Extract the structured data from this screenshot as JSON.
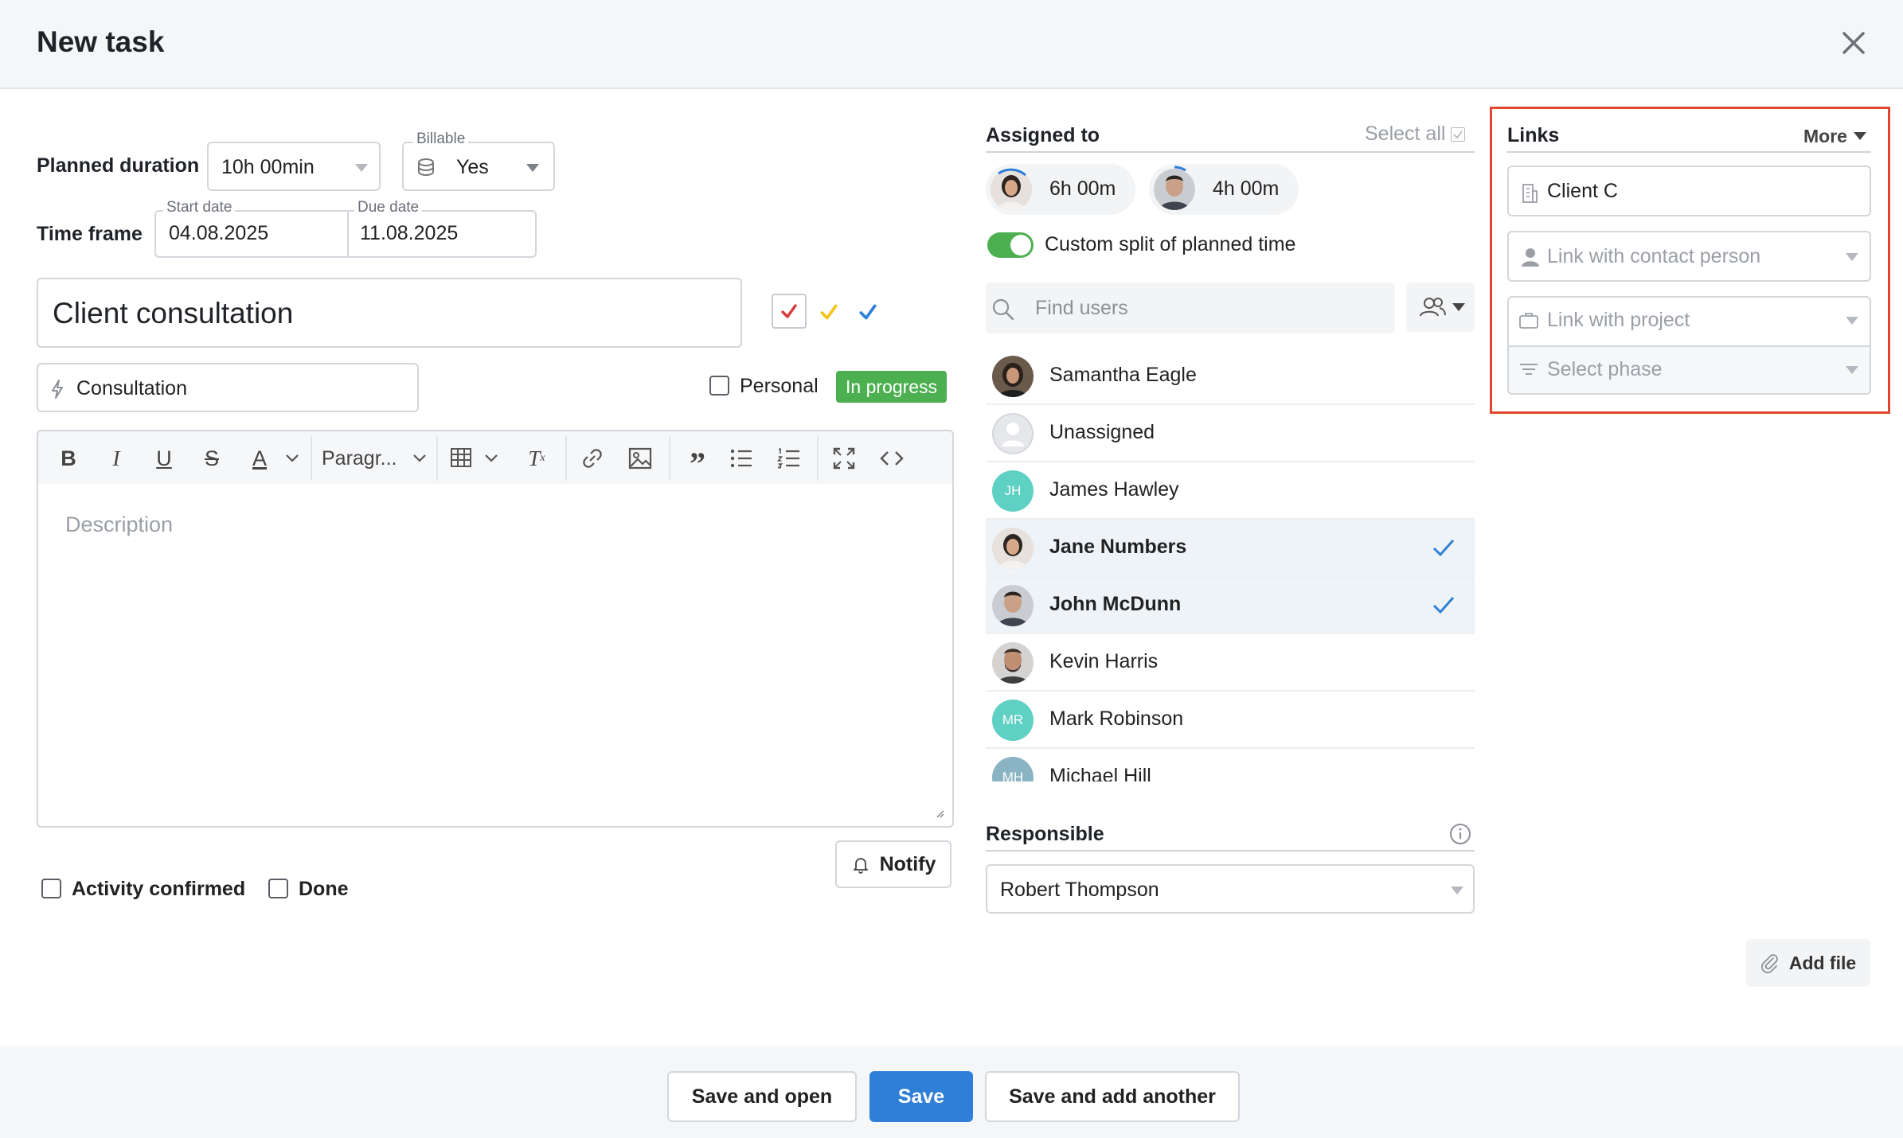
{
  "dialog": {
    "title": "New task"
  },
  "planned_duration": {
    "label": "Planned duration",
    "value": "10h 00min"
  },
  "billable": {
    "label": "Billable",
    "value": "Yes"
  },
  "time_frame": {
    "label": "Time frame",
    "start_label": "Start date",
    "start_value": "04.08.2025",
    "due_label": "Due date",
    "due_value": "11.08.2025"
  },
  "task_title": "Client consultation",
  "task_type": "Consultation",
  "personal_label": "Personal",
  "status_badge": "In progress",
  "toolbar": {
    "paragraph": "Paragr..."
  },
  "editor": {
    "placeholder": "Description"
  },
  "notify_label": "Notify",
  "activity_confirmed_label": "Activity confirmed",
  "done_label": "Done",
  "assigned": {
    "title": "Assigned to",
    "select_all": "Select all",
    "chips": [
      {
        "time": "6h 00m"
      },
      {
        "time": "4h 00m"
      }
    ],
    "custom_split_label": "Custom split of planned time",
    "search_placeholder": "Find users",
    "users": [
      {
        "name": "Samantha Eagle"
      },
      {
        "name": "Unassigned"
      },
      {
        "name": "James Hawley",
        "initials": "JH"
      },
      {
        "name": "Jane Numbers"
      },
      {
        "name": "John McDunn"
      },
      {
        "name": "Kevin Harris"
      },
      {
        "name": "Mark Robinson",
        "initials": "MR"
      },
      {
        "name": "Michael Hill",
        "initials": "MH"
      }
    ]
  },
  "responsible": {
    "title": "Responsible",
    "value": "Robert Thompson"
  },
  "links": {
    "title": "Links",
    "more": "More",
    "client": "Client C",
    "contact_placeholder": "Link with contact person",
    "project_placeholder": "Link with project",
    "phase_placeholder": "Select phase"
  },
  "add_file_label": "Add file",
  "footer": {
    "save_and_open": "Save and open",
    "save": "Save",
    "save_and_add": "Save and add another"
  },
  "colors": {
    "accent": "#2f7fd8",
    "status_green": "#4caf50",
    "toggle_green": "#4caf50",
    "highlight": "#e2462f",
    "teal_avatar": "#5fd0c4"
  }
}
